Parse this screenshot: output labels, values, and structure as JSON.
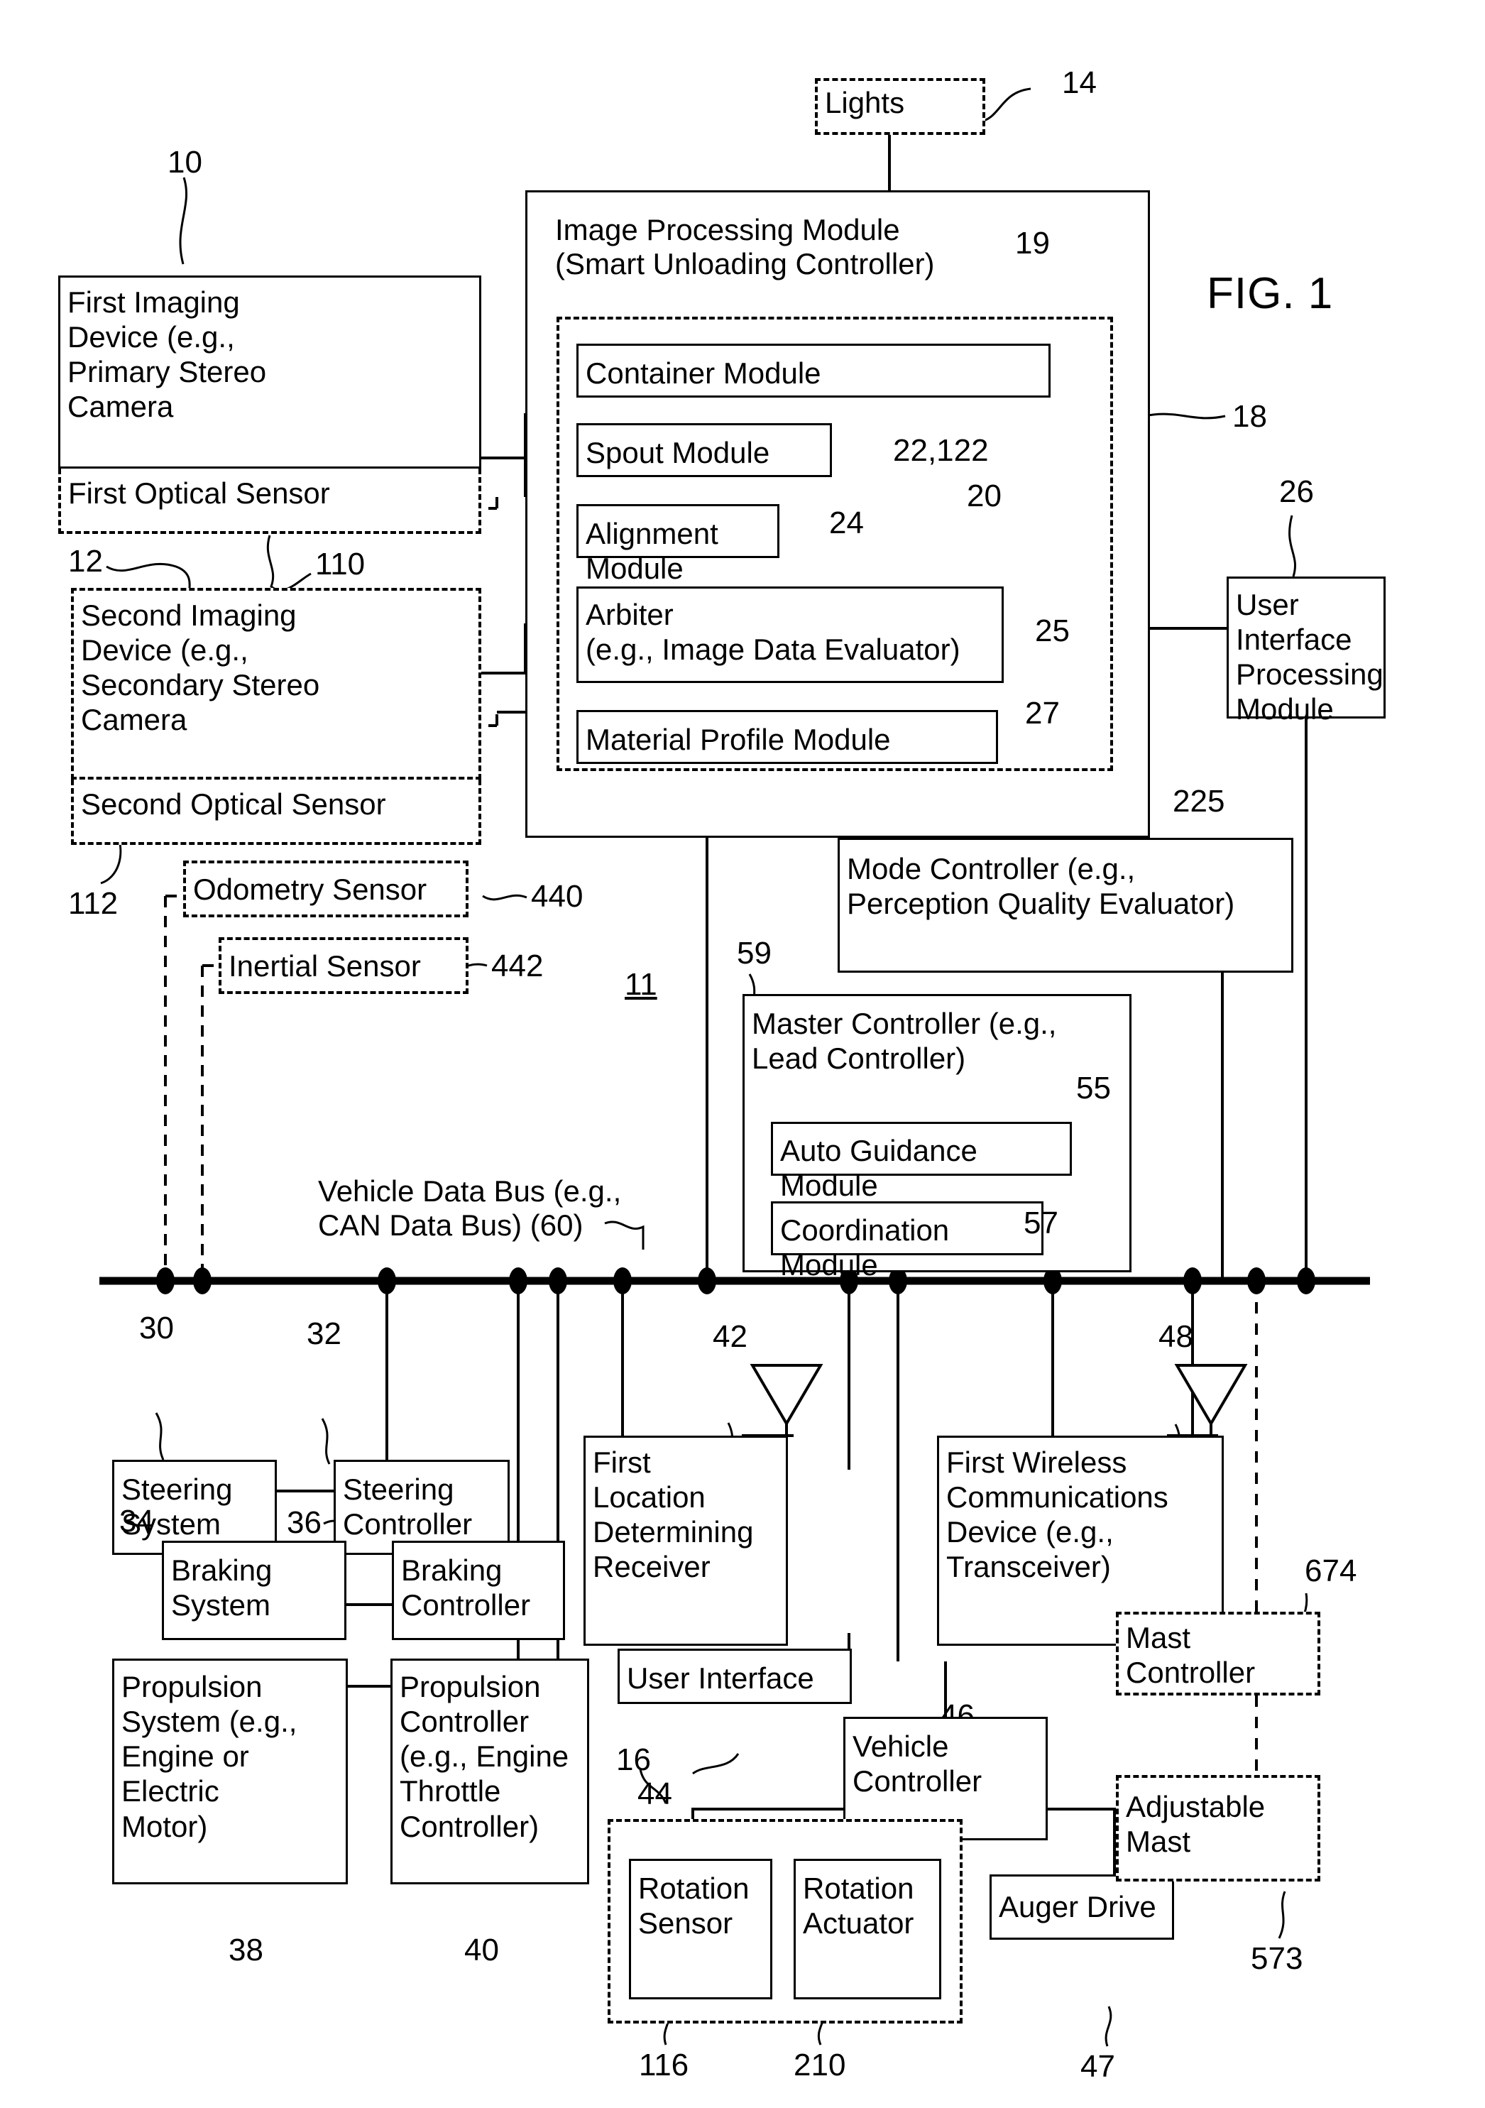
{
  "figure": {
    "label": "FIG. 1"
  },
  "blocks": {
    "lights": {
      "label": "Lights",
      "ref": "14"
    },
    "image_processing_module": {
      "label": "Image Processing Module\n(Smart Unloading Controller)",
      "ref": "18",
      "inner_group_ref": "19",
      "modules_ref": "20"
    },
    "container_module": {
      "label": "Container Module"
    },
    "spout_module": {
      "label": "Spout Module",
      "ref": "22,122"
    },
    "alignment_module": {
      "label": "Alignment Module",
      "ref": "24"
    },
    "arbiter": {
      "label": "Arbiter\n(e.g., Image Data Evaluator)",
      "ref": "25"
    },
    "material_profile_module": {
      "label": "Material Profile Module",
      "ref": "27"
    },
    "first_imaging_device": {
      "label": "First Imaging\nDevice (e.g.,\nPrimary Stereo\nCamera",
      "ref": "10"
    },
    "first_optical_sensor": {
      "label": "First Optical Sensor",
      "ref": "110",
      "group_ref": "12"
    },
    "second_imaging_device": {
      "label": "Second Imaging\nDevice (e.g.,\nSecondary Stereo\nCamera"
    },
    "second_optical_sensor": {
      "label": "Second Optical Sensor",
      "group_ref": "112"
    },
    "odometry_sensor": {
      "label": "Odometry Sensor",
      "ref": "440"
    },
    "inertial_sensor": {
      "label": "Inertial Sensor",
      "ref": "442"
    },
    "system_ref": "11",
    "user_interface_processing_module": {
      "label": "User Interface\nProcessing\nModule",
      "ref": "26"
    },
    "mode_controller": {
      "label": "Mode Controller (e.g.,\nPerception Quality Evaluator)",
      "ref": "225"
    },
    "master_controller": {
      "label": "Master Controller (e.g.,\nLead Controller)",
      "ref": "59"
    },
    "auto_guidance_module": {
      "label": "Auto Guidance Module",
      "ref": "55"
    },
    "coordination_module": {
      "label": "Coordination Module",
      "ref": "57"
    },
    "vehicle_data_bus": {
      "label": "Vehicle Data Bus (e.g.,\nCAN Data Bus) (60)"
    },
    "steering_system": {
      "label": "Steering\nSystem",
      "ref": "30"
    },
    "steering_controller": {
      "label": "Steering\nController",
      "ref": "32"
    },
    "braking_system": {
      "label": "Braking\nSystem",
      "ref": "34"
    },
    "braking_controller": {
      "label": "Braking\nController",
      "ref": "36"
    },
    "propulsion_system": {
      "label": "Propulsion\nSystem (e.g.,\nEngine or\nElectric\nMotor)",
      "ref": "38"
    },
    "propulsion_controller": {
      "label": "Propulsion\nController\n(e.g., Engine\nThrottle\nController)",
      "ref": "40"
    },
    "first_location_determining_receiver": {
      "label": "First\nLocation\nDetermining\nReceiver",
      "ref": "42"
    },
    "user_interface": {
      "label": "User Interface",
      "ref": "44"
    },
    "first_wireless_communications_device": {
      "label": "First Wireless\nCommunications\nDevice (e.g.,\nTransceiver)",
      "ref": "48"
    },
    "vehicle_controller": {
      "label": "Vehicle\nController",
      "ref": "46"
    },
    "rotation_sensor": {
      "label": "Rotation\nSensor",
      "ref": "116"
    },
    "rotation_actuator": {
      "label": "Rotation\nActuator",
      "ref": "210"
    },
    "rotation_group_ref": "16",
    "auger_drive": {
      "label": "Auger Drive",
      "ref": "47"
    },
    "mast_controller": {
      "label": "Mast\nController",
      "ref": "674"
    },
    "adjustable_mast": {
      "label": "Adjustable\nMast",
      "ref": "573"
    }
  }
}
